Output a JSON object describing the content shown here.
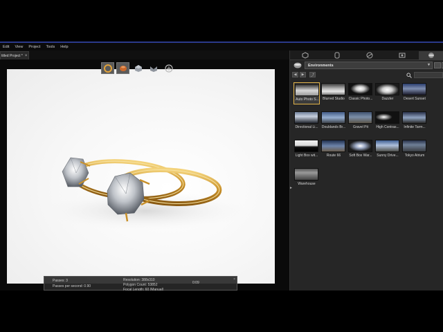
{
  "menu": [
    "Edit",
    "View",
    "Project",
    "Tools",
    "Help"
  ],
  "document_tab": {
    "title": "titled Project *",
    "close": "×"
  },
  "viewport_toolbar": [
    {
      "name": "render-mode-icon",
      "active": true
    },
    {
      "name": "material-mode-icon",
      "active": true
    },
    {
      "name": "geometry-icon",
      "active": false
    },
    {
      "name": "camera-icon",
      "active": false
    },
    {
      "name": "light-icon",
      "active": false
    }
  ],
  "hud": {
    "left_line1": "Passes: 3",
    "left_line2": "Passes per second: 0.90",
    "mid_line1": "Resolution: 388x310",
    "mid_line2": "Polygon Count: 53852",
    "mid_line3": "Focal Length: 60 (Manual)",
    "right": "0:09"
  },
  "panel": {
    "library": "Environments",
    "thumbnails": [
      {
        "label": "Auto Photo S...",
        "selected": true,
        "style": "studio"
      },
      {
        "label": "Blurred Studio",
        "selected": false,
        "style": "blur"
      },
      {
        "label": "Classic Photo...",
        "selected": false,
        "style": "dark"
      },
      {
        "label": "Dazzler",
        "selected": false,
        "style": "dazzler"
      },
      {
        "label": "Desert Sunset",
        "selected": false,
        "style": "sunset"
      },
      {
        "label": "Directional Li...",
        "selected": false,
        "style": "directional"
      },
      {
        "label": "Doublands Br...",
        "selected": false,
        "style": "sky"
      },
      {
        "label": "Gravel Pit",
        "selected": false,
        "style": "gravel"
      },
      {
        "label": "High Contras...",
        "selected": false,
        "style": "contrast"
      },
      {
        "label": "Infinite Tarm...",
        "selected": false,
        "style": "tarmac"
      },
      {
        "label": "Light Box wit...",
        "selected": false,
        "style": "lightbox"
      },
      {
        "label": "Route 66",
        "selected": false,
        "style": "route"
      },
      {
        "label": "Soft Box War...",
        "selected": false,
        "style": "softbox"
      },
      {
        "label": "Sunny Drive...",
        "selected": false,
        "style": "sunny"
      },
      {
        "label": "Tokyo Atrium",
        "selected": false,
        "style": "tokyo"
      },
      {
        "label": "Warehouse",
        "selected": false,
        "style": "warehouse"
      }
    ]
  },
  "colors": {
    "accent": "#e2b44a",
    "panel_bg": "#262626",
    "menu_strip": "#2b3a8c"
  }
}
